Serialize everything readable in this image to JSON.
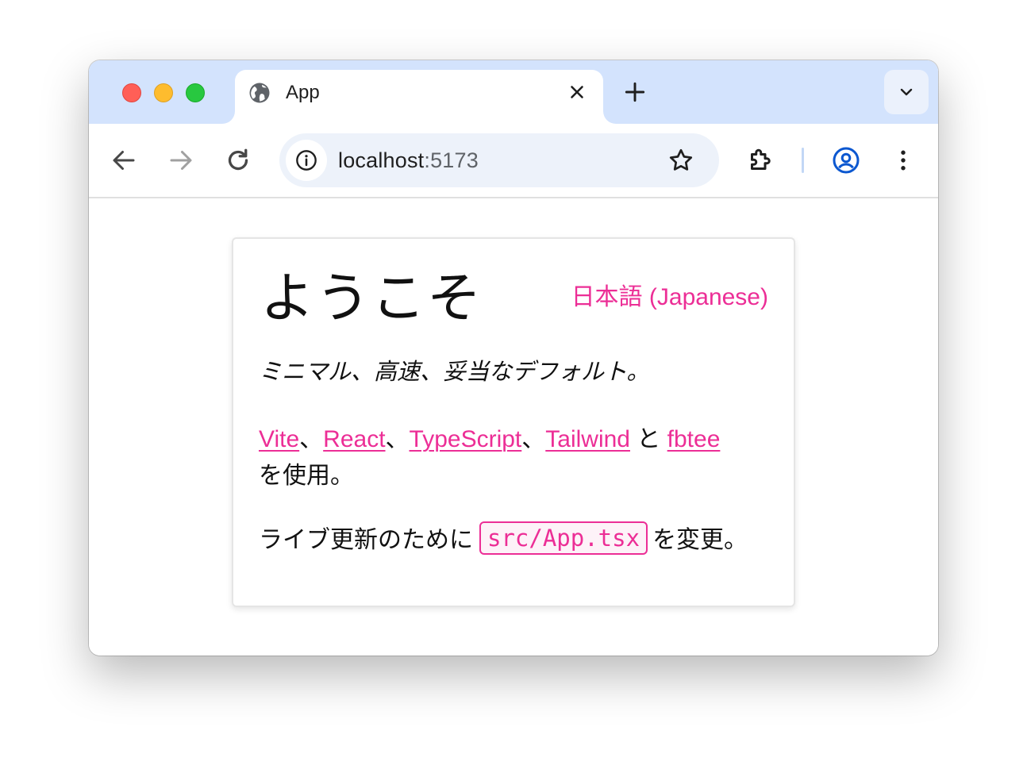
{
  "browser": {
    "tab": {
      "title": "App",
      "favicon": "globe-icon"
    },
    "address_bar": {
      "host": "localhost",
      "port": ":5173"
    },
    "icons": {
      "back": "arrow-left-icon",
      "forward": "arrow-right-icon",
      "reload": "reload-icon",
      "site_info": "info-icon",
      "bookmark": "star-icon",
      "extensions": "puzzle-icon",
      "profile": "account-icon",
      "menu": "more-vertical-icon",
      "new_tab": "plus-icon",
      "tab_search": "chevron-down-icon",
      "close_tab": "close-icon"
    },
    "colors": {
      "titlebar": "#d3e3fd",
      "omnibox": "#edf2fa",
      "profile_accent": "#0b57d0"
    }
  },
  "page": {
    "heading": "ようこそ",
    "language_link": "日本語 (Japanese)",
    "tagline": "ミニマル、高速、妥当なデフォルト。",
    "built_with": {
      "links": [
        "Vite",
        "React",
        "TypeScript",
        "Tailwind",
        "fbtee"
      ],
      "separator": "、",
      "and_word": " と ",
      "suffix": "を使用。"
    },
    "edit_hint": {
      "before": "ライブ更新のために",
      "file": "src/App.tsx",
      "after": "を変更。"
    },
    "colors": {
      "accent": "#ec2e96",
      "text": "#111111"
    }
  }
}
